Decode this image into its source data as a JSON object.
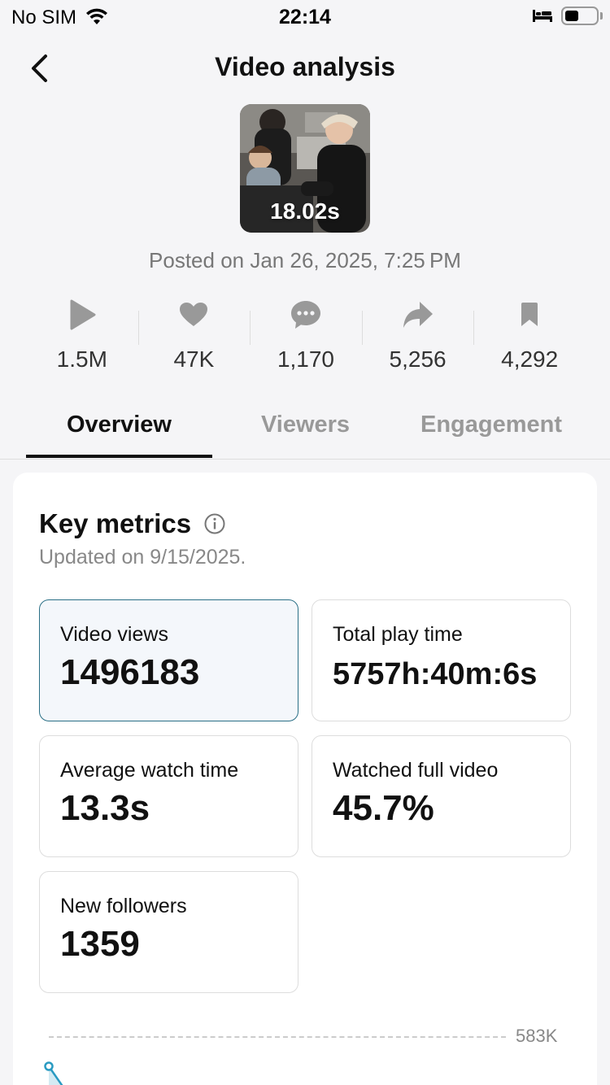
{
  "status_bar": {
    "carrier": "No SIM",
    "time": "22:14",
    "battery_level": 0.45
  },
  "header": {
    "title": "Video analysis"
  },
  "video": {
    "duration": "18.02s",
    "posted": "Posted on Jan 26, 2025, 7:25 PM"
  },
  "stats": [
    {
      "icon": "play-icon",
      "value": "1.5M"
    },
    {
      "icon": "heart-icon",
      "value": "47K"
    },
    {
      "icon": "comment-icon",
      "value": "1,170"
    },
    {
      "icon": "share-icon",
      "value": "5,256"
    },
    {
      "icon": "bookmark-icon",
      "value": "4,292"
    }
  ],
  "tabs": [
    {
      "label": "Overview",
      "active": true
    },
    {
      "label": "Viewers",
      "active": false
    },
    {
      "label": "Engagement",
      "active": false
    }
  ],
  "key_metrics": {
    "title": "Key metrics",
    "updated": "Updated on 9/15/2025.",
    "metrics": [
      {
        "label": "Video views",
        "value": "1496183",
        "selected": true
      },
      {
        "label": "Total play time",
        "value": "5757h:40m:6s",
        "selected": false
      },
      {
        "label": "Average watch time",
        "value": "13.3s",
        "selected": false
      },
      {
        "label": "Watched full video",
        "value": "45.7%",
        "selected": false
      },
      {
        "label": "New followers",
        "value": "1359",
        "selected": false
      }
    ]
  },
  "chart": {
    "max_label": "583K",
    "accent": "#2a9bc2"
  },
  "colors": {
    "accent": "#2a6f86",
    "muted": "#999999"
  }
}
